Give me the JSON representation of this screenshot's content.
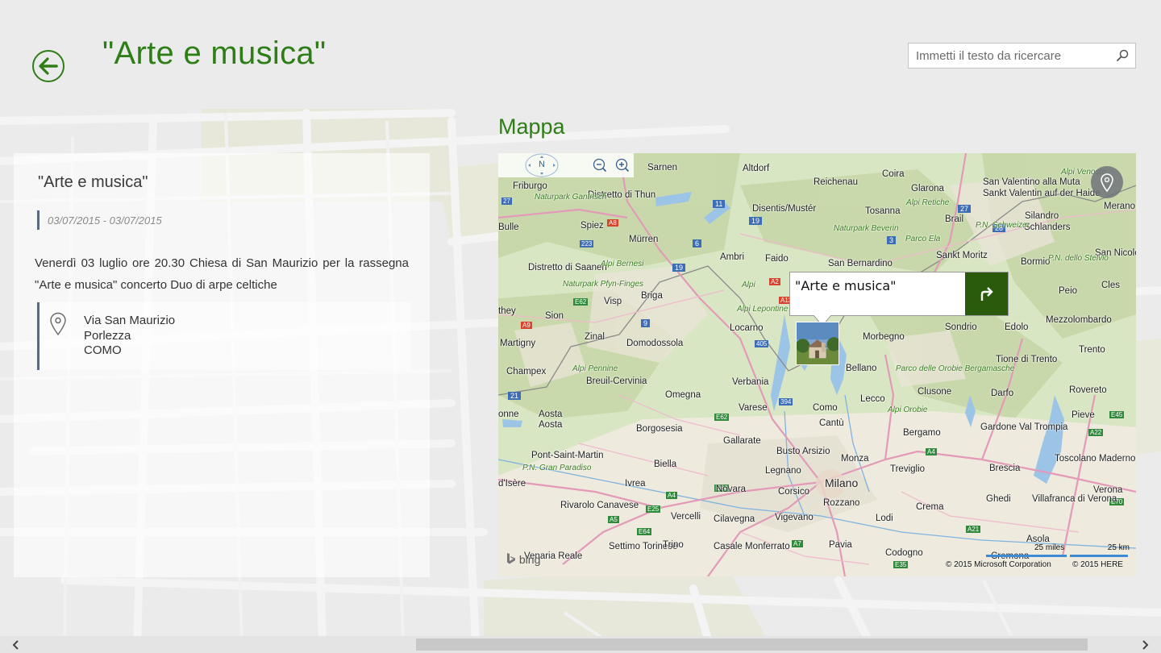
{
  "header": {
    "title": "\"Arte e musica\"",
    "search_placeholder": "Immetti il testo da ricercare"
  },
  "event": {
    "title": "\"Arte e musica\"",
    "date_range": "03/07/2015 - 03/07/2015",
    "description": "Venerdì 03 luglio ore 20.30 Chiesa di San Maurizio per la rassegna \"Arte e musica\" concerto Duo di arpe celtiche",
    "address": {
      "street": "Via San Maurizio",
      "city": "Porlezza",
      "province": "COMO"
    }
  },
  "map_section": {
    "title": "Mappa",
    "compass_label": "N",
    "popup_title": "\"Arte e musica\"",
    "labels": {
      "sarnen": "Sarnen",
      "altdorf": "Altdorf",
      "reichenau": "Reichenau",
      "coira": "Coira",
      "glarona": "Glarona",
      "san_valentino": "San Valentino alla Muta",
      "sankt_valentin": "Sankt Valentin auf der Haide",
      "friburgo": "Friburgo",
      "distretto_thun": "Distretto di Thun",
      "disentis": "Disentis/Mustér",
      "tosanna": "Tosanna",
      "brail": "Brail",
      "silandro": "Silandro",
      "schlanders": "Schlanders",
      "merano": "Merano",
      "bulle": "Bulle",
      "spiez": "Spiez",
      "murren": "Mürren",
      "ambri": "Ambri",
      "faido": "Faido",
      "san_bernardino": "San Bernardino",
      "sankt_moritz": "Sankt Moritz",
      "bormio": "Bormio",
      "san_nicolo": "San Nicolò",
      "distretto_saanen": "Distretto di Saanen",
      "briga": "Briga",
      "visp": "Visp",
      "peio": "Peio",
      "cles": "Cles",
      "sion": "Sion",
      "zinal": "Zinal",
      "locarno": "Locarno",
      "morbegno": "Morbegno",
      "sondrio": "Sondrio",
      "edolo": "Edolo",
      "mezzolombardo": "Mezzolombardo",
      "martigny": "Martigny",
      "domodossola": "Domodossola",
      "trento": "Trento",
      "champex": "Champex",
      "breuil": "Breuil-Cervinia",
      "bellano": "Bellano",
      "tione": "Tione di Trento",
      "verbania": "Verbania",
      "omegna": "Omegna",
      "lecco": "Lecco",
      "clusone": "Clusone",
      "darfo": "Darfo",
      "rovereto": "Rovereto",
      "aosta": "Aosta",
      "varese": "Varese",
      "como": "Como",
      "borgosesia": "Borgosesia",
      "cantu": "Cantù",
      "bergamo": "Bergamo",
      "gardone": "Gardone Val Trompia",
      "pieve": "Pieve",
      "gallarate": "Gallarate",
      "busto": "Busto Arsizio",
      "pont_saint_martin": "Pont-Saint-Martin",
      "biella": "Biella",
      "legnano": "Legnano",
      "monza": "Monza",
      "treviglio": "Treviglio",
      "brescia": "Brescia",
      "toscolano": "Toscolano Maderno",
      "ivrea": "Ivrea",
      "novara": "Novara",
      "corsico": "Corsico",
      "milano": "Milano",
      "verona": "Verona",
      "rivarolo": "Rivarolo Canavese",
      "rozzano": "Rozzano",
      "crema": "Crema",
      "ghedi": "Ghedi",
      "villafranca": "Villafranca di Verona",
      "vercelli": "Vercelli",
      "cilavegna": "Cilavegna",
      "vigevano": "Vigevano",
      "lodi": "Lodi",
      "asola": "Asola",
      "settimo": "Settimo Torinese",
      "trino": "Trino",
      "casale": "Casale Monferrato",
      "pavia": "Pavia",
      "codogno": "Codogno",
      "venaria": "Venaria Reale",
      "cremona": "Cremona",
      "park_gantrisch": "Naturpark Gantrisch",
      "park_bernesi": "Alpi Bernesi",
      "park_pfyn": "Naturpark Pfyn-Finges",
      "park_beverin": "Naturpark Beverin",
      "park_ela": "Parco Ela",
      "park_retiche": "Alpi Retiche",
      "park_schweizer": "P.N. Schweizer",
      "park_stelvio": "P.N. dello Stelvio",
      "park_pennine": "Alpi Pennine",
      "park_orobie_berg": "Parco delle Orobie Bergamasche",
      "park_orobie": "Alpi Orobie",
      "park_gran_paradiso": "P.N. Gran Paradiso",
      "park_lepontine": "Alpi Lepontine",
      "alpi": "Alpi",
      "alpi_venoste": "Alpi Venoste",
      "isere": "d'Isère",
      "onne": "onne",
      "thrhey": "they"
    },
    "road_shields": [
      "27",
      "11",
      "19",
      "6",
      "A8",
      "223",
      "19",
      "27",
      "28",
      "3",
      "A2",
      "A13",
      "E62",
      "A9",
      "9",
      "405",
      "21",
      "394",
      "E62",
      "E64",
      "A4",
      "A4",
      "A5",
      "E25",
      "E64",
      "A7",
      "E35",
      "E45",
      "A22",
      "A21",
      "E70"
    ],
    "attribution": {
      "bing": "bing",
      "scale_miles": "25 miles",
      "scale_km": "25 km",
      "copyright_ms": "© 2015 Microsoft Corporation",
      "copyright_here": "© 2015 HERE"
    }
  },
  "colors": {
    "accent": "#2e7d17",
    "directions_button": "#2a5a0c",
    "address_border": "#5a6a7e"
  }
}
